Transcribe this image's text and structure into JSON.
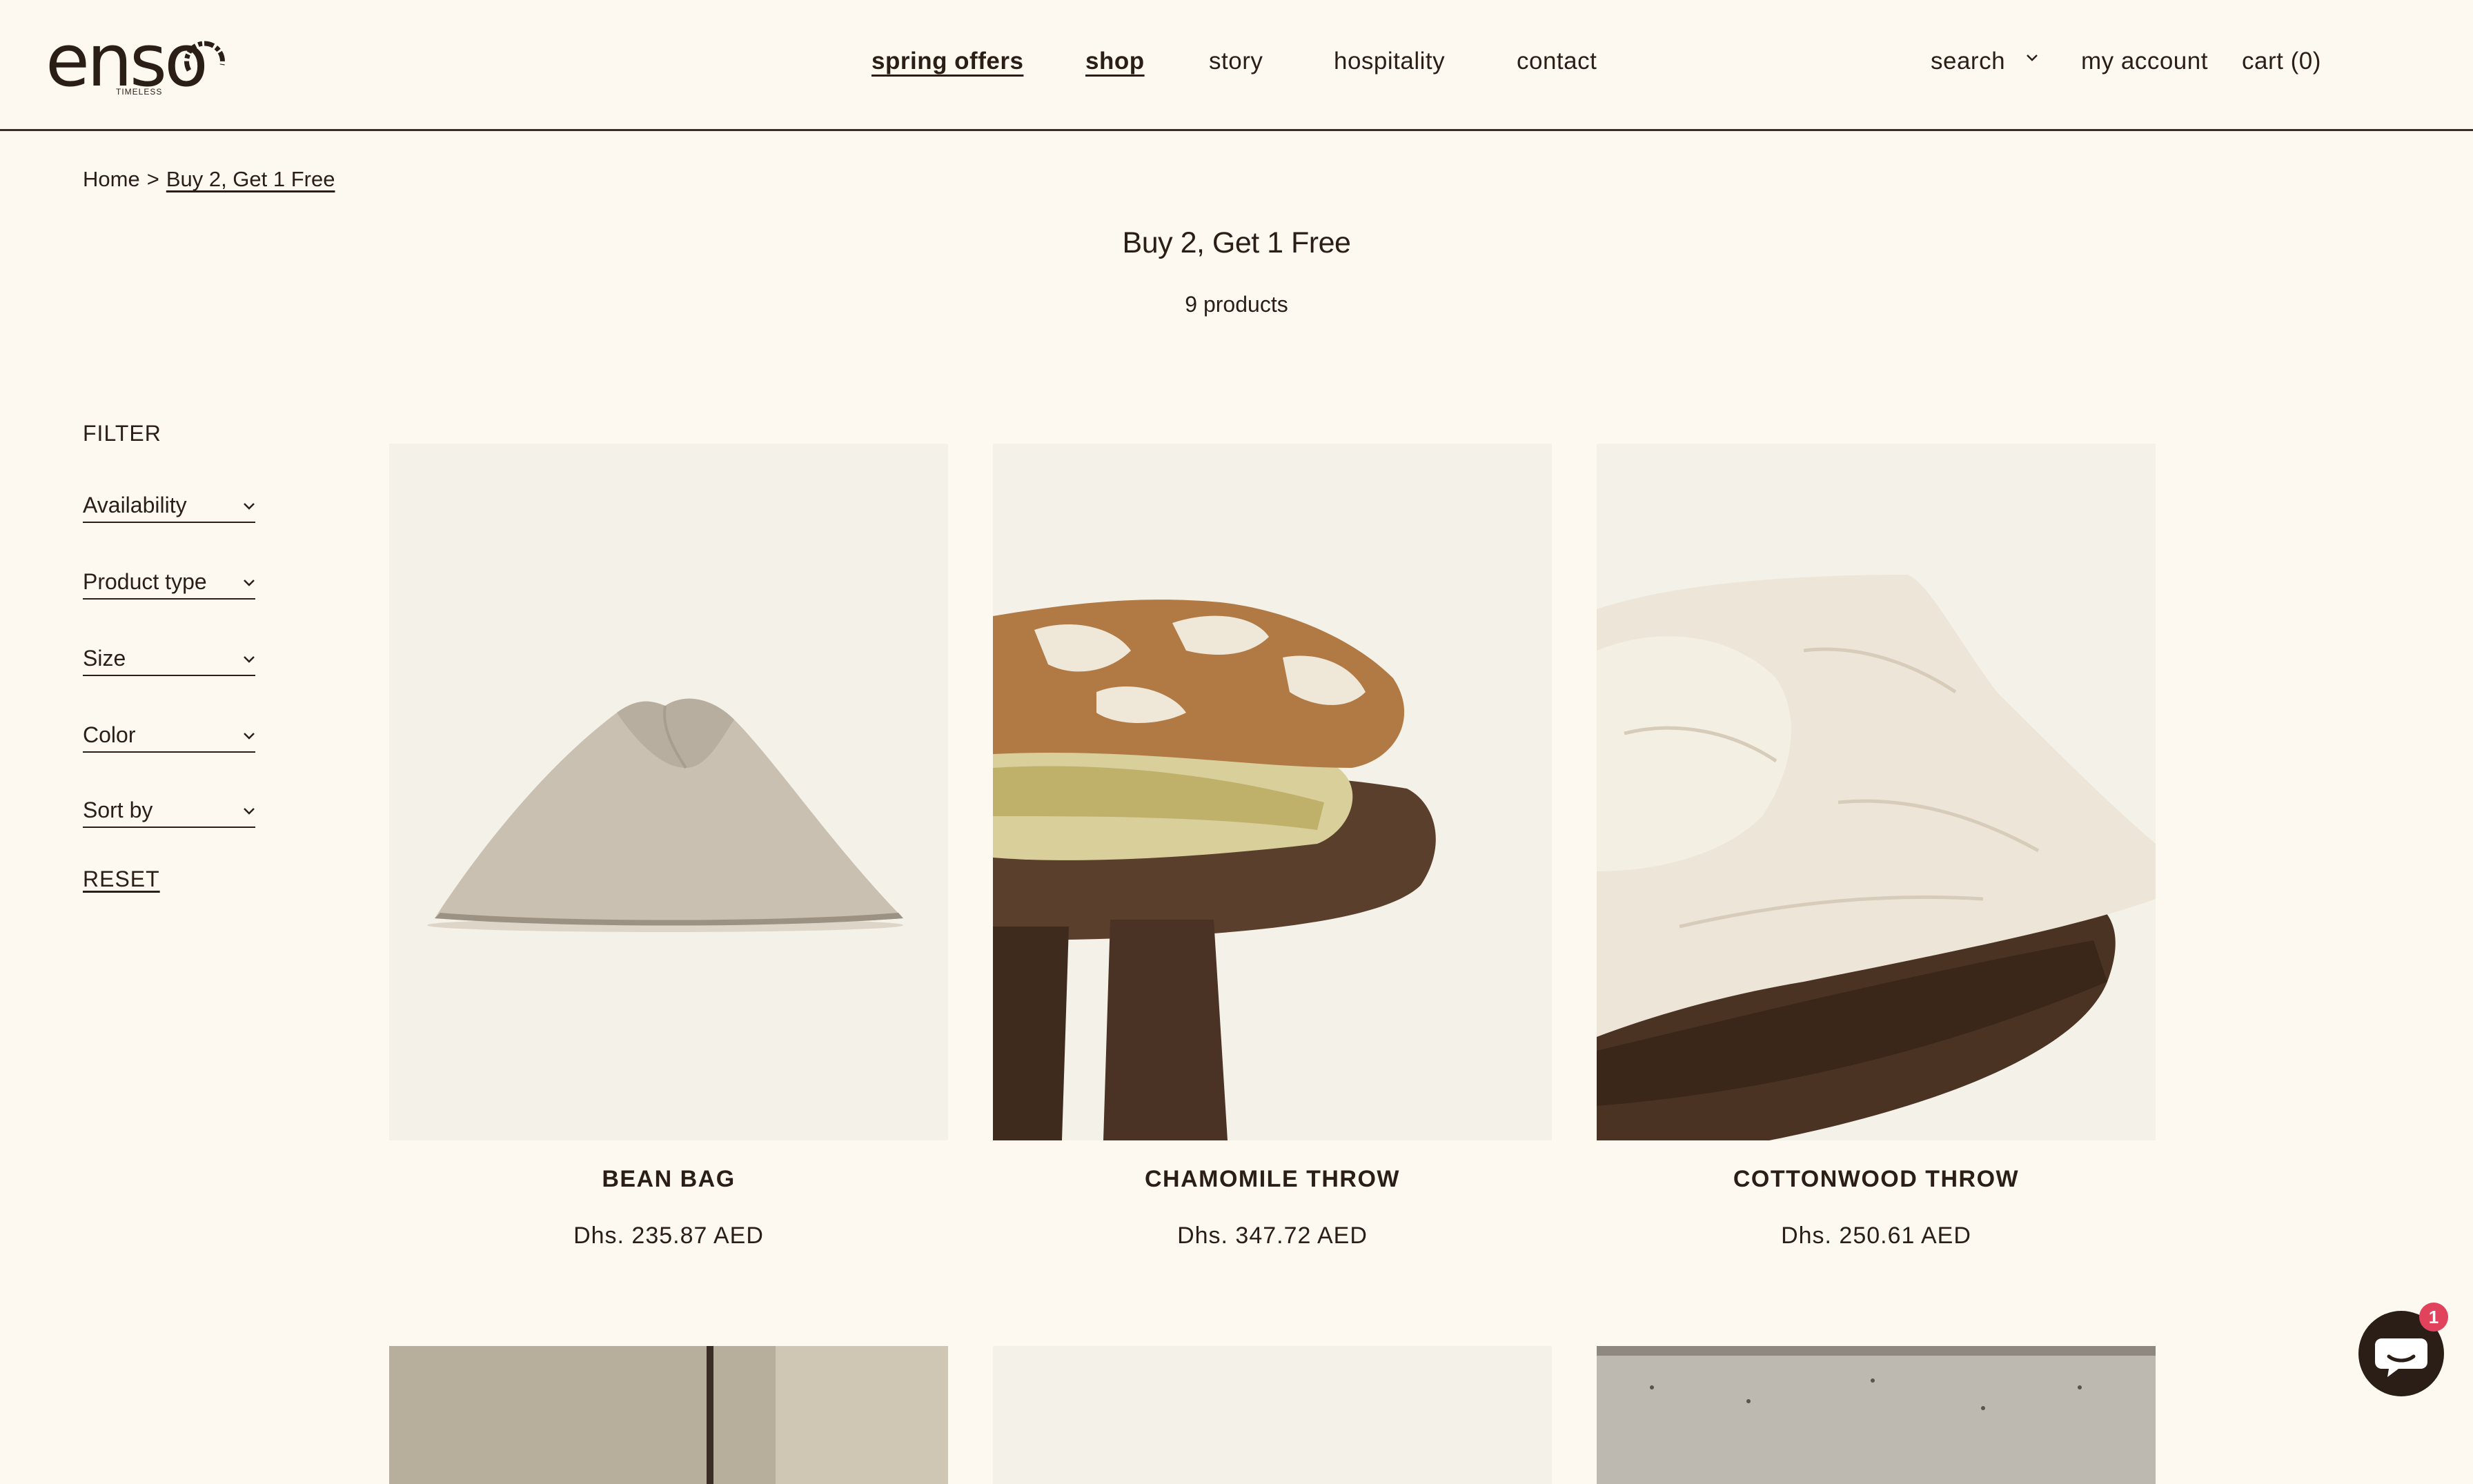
{
  "brand": {
    "wordmark": "enso",
    "tagline": "TIMELESS"
  },
  "nav": {
    "items": [
      "spring offers",
      "shop",
      "story",
      "hospitality",
      "contact"
    ]
  },
  "utility": {
    "search": "search",
    "account": "my account",
    "cart": "cart (0)"
  },
  "breadcrumb": {
    "home": "Home",
    "separator": ">",
    "current": "Buy 2, Get 1 Free"
  },
  "collection": {
    "title": "Buy 2, Get 1 Free",
    "count": "9 products"
  },
  "filter": {
    "title": "FILTER",
    "options": [
      "Availability",
      "Product type",
      "Size",
      "Color",
      "Sort by"
    ],
    "reset": "RESET"
  },
  "products": [
    {
      "name": "BEAN BAG",
      "price": "Dhs. 235.87 AED"
    },
    {
      "name": "CHAMOMILE THROW",
      "price": "Dhs. 347.72 AED"
    },
    {
      "name": "COTTONWOOD THROW",
      "price": "Dhs. 250.61 AED"
    }
  ],
  "chat": {
    "badge": "1"
  },
  "colors": {
    "background": "#fdf9f1",
    "text": "#2a1e17",
    "badge": "#e0435b",
    "image_bg": "#f4f1e8"
  }
}
